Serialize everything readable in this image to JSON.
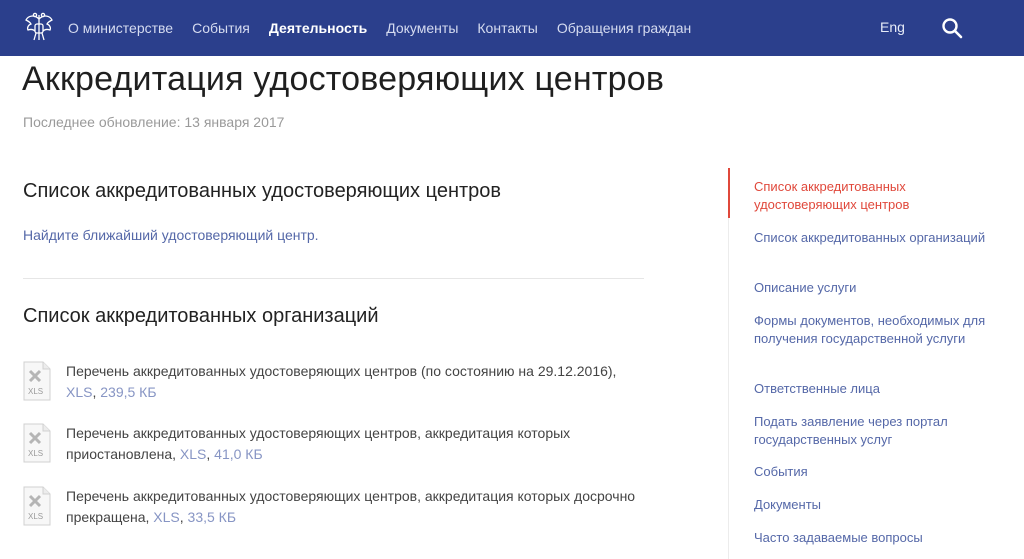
{
  "header": {
    "nav": [
      {
        "label": "О министерстве",
        "active": false
      },
      {
        "label": "События",
        "active": false
      },
      {
        "label": "Деятельность",
        "active": true
      },
      {
        "label": "Документы",
        "active": false
      },
      {
        "label": "Контакты",
        "active": false
      },
      {
        "label": "Обращения граждан",
        "active": false
      }
    ],
    "lang_label": "Eng",
    "brand_bg": "#2b3f8c",
    "emblem_icon": "state-emblem-icon",
    "search_icon": "search-icon"
  },
  "page": {
    "title": "Аккредитация удостоверяющих центров",
    "updated": "Последнее обновление: 13 января 2017"
  },
  "sections": {
    "s1_title": "Список аккредитованных удостоверяющих центров",
    "s1_link": "Найдите ближайший удостоверяющий центр.",
    "s2_title": "Список аккредитованных организаций"
  },
  "files": [
    {
      "text": "Перечень аккредитованных удостоверяющих центров (по состоянию на 29.12.2016),",
      "format": "XLS",
      "size": "239,5 КБ",
      "icon_label": "XLS"
    },
    {
      "text": "Перечень аккредитованных удостоверяющих центров, аккредитация которых приостановлена,",
      "format": "XLS",
      "size": "41,0 КБ",
      "icon_label": "XLS"
    },
    {
      "text": "Перечень аккредитованных удостоверяющих центров, аккредитация которых досрочно прекращена,",
      "format": "XLS",
      "size": "33,5 КБ",
      "icon_label": "XLS"
    }
  ],
  "sidebar": {
    "items": [
      {
        "label": "Список аккредитованных удостоверяющих центров",
        "active": true
      },
      {
        "label": "Список аккредитованных организаций",
        "active": false
      },
      {
        "label": "Описание услуги",
        "active": false
      },
      {
        "label": "Формы документов, необходимых для получения государственной услуги",
        "active": false
      },
      {
        "label": "Ответственные лица",
        "active": false
      },
      {
        "label": "Подать заявление через портал государственных услуг",
        "active": false
      },
      {
        "label": "События",
        "active": false
      },
      {
        "label": "Документы",
        "active": false
      },
      {
        "label": "Часто задаваемые вопросы",
        "active": false
      }
    ],
    "active_color": "#e0483b",
    "link_color": "#5568a8"
  }
}
